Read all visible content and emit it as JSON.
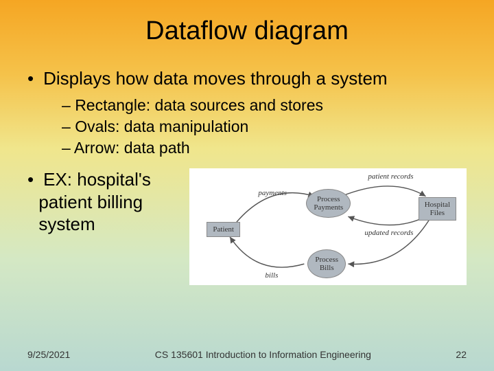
{
  "title": "Dataflow diagram",
  "bullets": {
    "main1": "Displays how data moves through a system",
    "sub1": "Rectangle: data sources and stores",
    "sub2": "Ovals: data manipulation",
    "sub3": "Arrow: data path",
    "main2_line1": "EX: hospital's",
    "main2_line2": "patient billing",
    "main2_line3": "system"
  },
  "diagram": {
    "nodes": {
      "patient": "Patient",
      "hospital": "Hospital\nFiles",
      "process_payments": "Process\nPayments",
      "process_bills": "Process\nBills"
    },
    "edges": {
      "payments": "payments",
      "patient_records": "patient records",
      "updated_records": "updated records",
      "bills": "bills"
    }
  },
  "footer": {
    "date": "9/25/2021",
    "course": "CS 135601 Introduction to Information Engineering",
    "page": "22"
  }
}
